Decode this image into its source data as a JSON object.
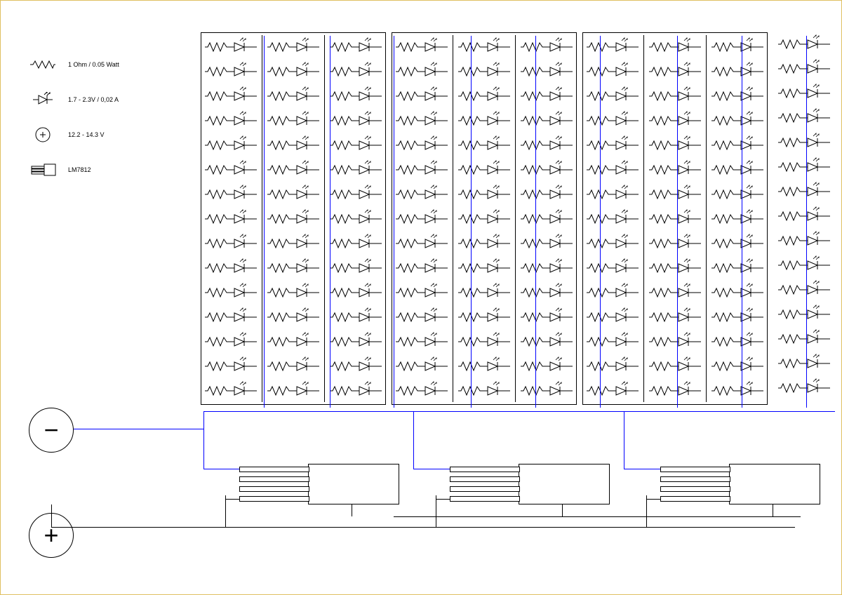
{
  "legend": {
    "resistor": "1 Ohm / 0.05 Watt",
    "led": "1.7 - 2.3V / 0,02 A",
    "source": "12.2 - 14.3 V",
    "regulator": "LM7812"
  },
  "layout": {
    "rows_per_column": 15,
    "columns_per_group": 3,
    "groups": 3,
    "extra_right_column": 1
  },
  "components": {
    "resistor_type": "resistor-zigzag",
    "led_type": "led-diode",
    "source_type": "dc-source-circle",
    "regulator_type": "voltage-regulator-3pin"
  }
}
